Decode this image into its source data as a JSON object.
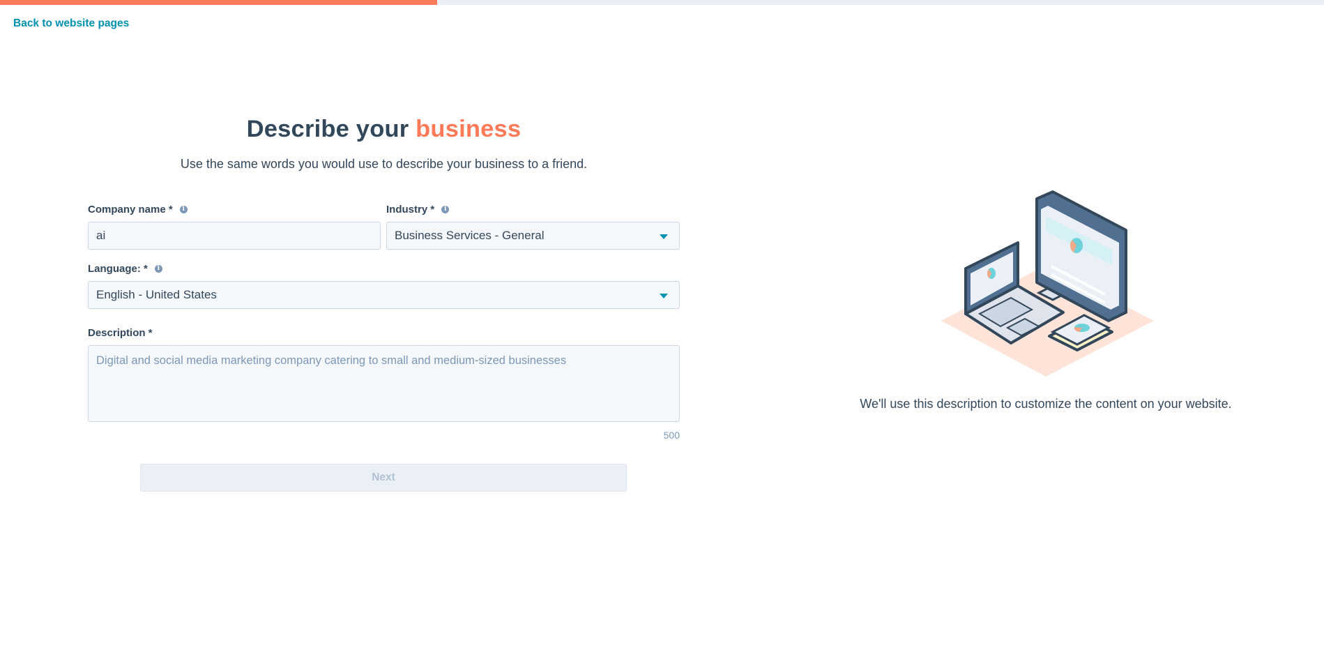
{
  "progress": {
    "fraction": 0.33
  },
  "nav": {
    "back_label": "Back to website pages"
  },
  "header": {
    "title_prefix": "Describe your ",
    "title_accent": "business",
    "subtitle": "Use the same words you would use to describe your business to a friend."
  },
  "form": {
    "company": {
      "label": "Company name *",
      "value": "ai"
    },
    "industry": {
      "label": "Industry *",
      "value": "Business Services - General"
    },
    "language": {
      "label": "Language: *",
      "value": "English - United States"
    },
    "description": {
      "label": "Description *",
      "placeholder": "Digital and social media marketing company catering to small and medium-sized businesses",
      "counter": "500"
    },
    "next_label": "Next"
  },
  "aside": {
    "helper_text": "We'll use this description to customize the content on your website."
  },
  "colors": {
    "accent": "#ff7a59",
    "link": "#0091ae",
    "text": "#33475b"
  }
}
